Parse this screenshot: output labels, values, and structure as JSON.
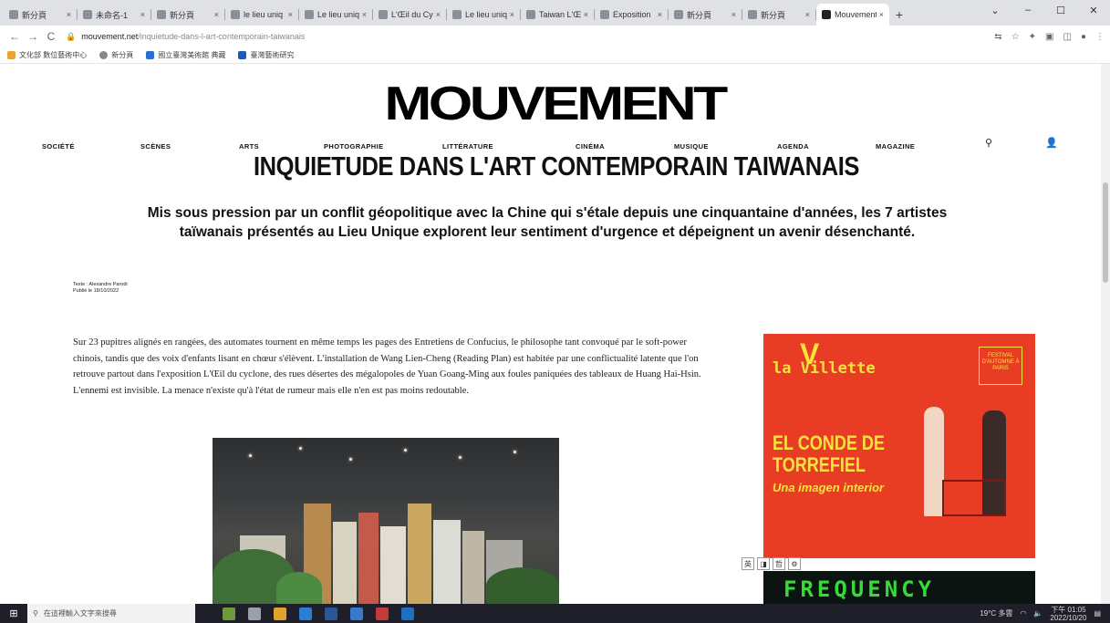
{
  "browser": {
    "tabs": [
      {
        "label": "新分頁",
        "active": false
      },
      {
        "label": "未命名-1",
        "active": false
      },
      {
        "label": "新分頁",
        "active": false
      },
      {
        "label": "le lieu uniq",
        "active": false
      },
      {
        "label": "Le lieu uniq",
        "active": false
      },
      {
        "label": "L'Œil du Cy",
        "active": false
      },
      {
        "label": "Le lieu uniq",
        "active": false
      },
      {
        "label": "Taiwan L'Œi",
        "active": false
      },
      {
        "label": "Exposition",
        "active": false
      },
      {
        "label": "新分頁",
        "active": false
      },
      {
        "label": "新分頁",
        "active": false
      },
      {
        "label": "Mouvement",
        "active": true
      }
    ],
    "new_tab": "+",
    "window_controls": [
      "⌄",
      "–",
      "☐",
      "✕"
    ],
    "url_host": "mouvement.net",
    "url_path": "/inquietude-dans-l-art-contemporain-taiwanais",
    "bookmarks": [
      "文化部 數位藝術中心",
      "新分頁",
      "國立臺灣美術館 典藏",
      "臺灣藝術研究"
    ]
  },
  "site": {
    "logo": "MOUVEMENT",
    "nav": [
      "SOCIÉTÉ",
      "SCÈNES",
      "ARTS",
      "PHOTOGRAPHIE",
      "LITTÉRATURE",
      "CINÉMA",
      "MUSIQUE",
      "AGENDA",
      "MAGAZINE"
    ]
  },
  "article": {
    "title": "INQUIETUDE DANS L'ART CONTEMPORAIN TAIWANAIS",
    "standfirst": "Mis sous pression par un conflit géopolitique avec la Chine qui s'étale depuis une cinquantaine d'années, les 7 artistes taïwanais présentés au Lieu Unique explorent leur sentiment d'urgence et dépeignent un avenir désenchanté.",
    "credit_author": "Texte : Alexandre Parodi",
    "credit_date": "Publié le 18/10/2022",
    "body": "Sur 23 pupitres alignés en rangées, des automates tournent en même temps les pages des Entretiens de Confucius, le philosophe tant convoqué par le soft-power chinois, tandis que des voix d'enfants lisant en chœur s'élèvent. L'installation de Wang Lien-Cheng (Reading Plan) est habitée par une conflictualité latente que l'on retrouve partout dans l'exposition L'Œil du cyclone, des rues désertes des mégalopoles de Yuan Goang-Ming aux foules paniquées des tableaux de Huang Hai-Hsin. L'ennemi est invisible. La menace n'existe qu'à l'état de rumeur mais elle n'en est pas moins redoutable."
  },
  "ad": {
    "brand": "la Villette",
    "badge": "FESTIVAL D'AUTOMNE À PARIS",
    "title": "EL CONDE DE TORREFIEL",
    "subtitle": "Una imagen interior",
    "strip": [
      "英",
      "◨",
      "哲",
      "⚙"
    ],
    "second": "FREQUENCY"
  },
  "taskbar": {
    "search_placeholder": "在這裡輸入文字來搜尋",
    "weather": "19°C 多雲",
    "time": "下午 01:05",
    "date": "2022/10/20"
  }
}
